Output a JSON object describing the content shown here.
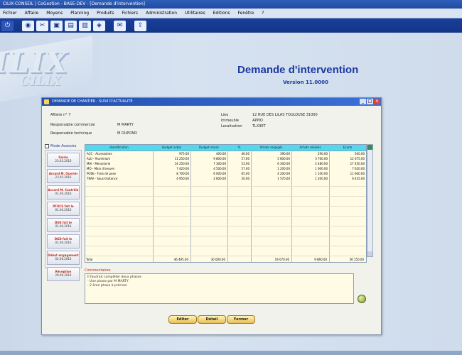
{
  "titlebar": {
    "text": "CILIX-CONSEIL | CoGestion - BASE-DEV - [Demande d'intervention]"
  },
  "menu": [
    "Fichier",
    "Affaire",
    "Moyens",
    "Planning",
    "Produits",
    "Fichiers",
    "Administration",
    "Utilitaires",
    "Editions",
    "Fenêtre",
    "?"
  ],
  "toolbar": [
    "exit-icon",
    "eye-icon",
    "tools-icon",
    "box-icon",
    "chart-icon",
    "folder-icon",
    "tag-icon",
    "mail-icon",
    "import-icon"
  ],
  "brand": {
    "logo_big": "ILIX",
    "logo_small": "CILIX"
  },
  "app": {
    "title": "Demande d'intervention",
    "version": "Version 11.0000"
  },
  "window": {
    "title": "DEMANDE DE CHANTIER : SUIVI D'ACTUALITE",
    "affaire_label": "Affaire n° 7",
    "resp_com_label": "Responsable commercial",
    "resp_com_value": "M MARTY",
    "resp_tech_label": "Responsable technique",
    "resp_tech_value": "M DUPOND",
    "lieu_label": "Lieu",
    "lieu_value": "12 RUE DES LILAS TOULOUSE 31000",
    "immeuble_label": "Immeuble",
    "immeuble_value": "APPIO",
    "local_label": "Localisation",
    "local_value": "TLX3ET"
  },
  "mode_label": "Mode Avancée",
  "steps": [
    {
      "title": "Saisie",
      "date": "23.05.2016"
    },
    {
      "title": "Accord M. Ouvrier",
      "date": "23.05.2016"
    },
    {
      "title": "Accord M. Contrôle",
      "date": "01.06.2016"
    },
    {
      "title": "PFUCS fait le",
      "date": "01.06.2016"
    },
    {
      "title": "DOE fait le",
      "date": "01.06.2016"
    },
    {
      "title": "DGD fait le",
      "date": "01.06.2016"
    },
    {
      "title": "Début engagement",
      "date": "02.06.2016"
    },
    {
      "title": "Réception",
      "date": "29.06.2016"
    }
  ],
  "table": {
    "headers": [
      "Identification",
      "Budget initial",
      "Budget révisé",
      "%",
      "Achats engagés",
      "Achats réalisés",
      "Ecarts"
    ],
    "rows": [
      [
        "ACC - Accessoires",
        "975.00",
        "400.00",
        "46.00",
        "390.00",
        "290.00",
        "500.00"
      ],
      [
        "ALU - Aluminium",
        "11 250.00",
        "9 800.00",
        "57.00",
        "5 600.00",
        "3 760.00",
        "12 675.00"
      ],
      [
        "MAI - Menuiserie",
        "14 250.00",
        "7 300.00",
        "53.00",
        "6 300.00",
        "2 480.00",
        "17 450.00"
      ],
      [
        "MO - Main d'oeuvre",
        "7 420.00",
        "4 500.00",
        "57.00",
        "1 200.00",
        "1 000.00",
        "7 620.00"
      ],
      [
        "POSE - Frais de pose",
        "8 700.00",
        "6 000.00",
        "65.00",
        "4 200.00",
        "1 100.00",
        "11 600.00"
      ],
      [
        "TRAV - Sous-traitance",
        "4 950.00",
        "2 600.00",
        "50.00",
        "1 570.00",
        "1 200.00",
        "6 435.00"
      ]
    ],
    "total_label": "Total",
    "totals": [
      "46 495.00",
      "30 000.00",
      "",
      "19 070.00",
      "9 860.00",
      "56 150.00"
    ]
  },
  "comments": {
    "label": "Commentaires",
    "lines": [
      "Il faudrait compléter deux phases",
      "- Une phase par M MARTY",
      "- 2 ème phase à préciser"
    ]
  },
  "buttons": {
    "edit": "Editer",
    "detail": "Détail",
    "close": "Fermer"
  }
}
